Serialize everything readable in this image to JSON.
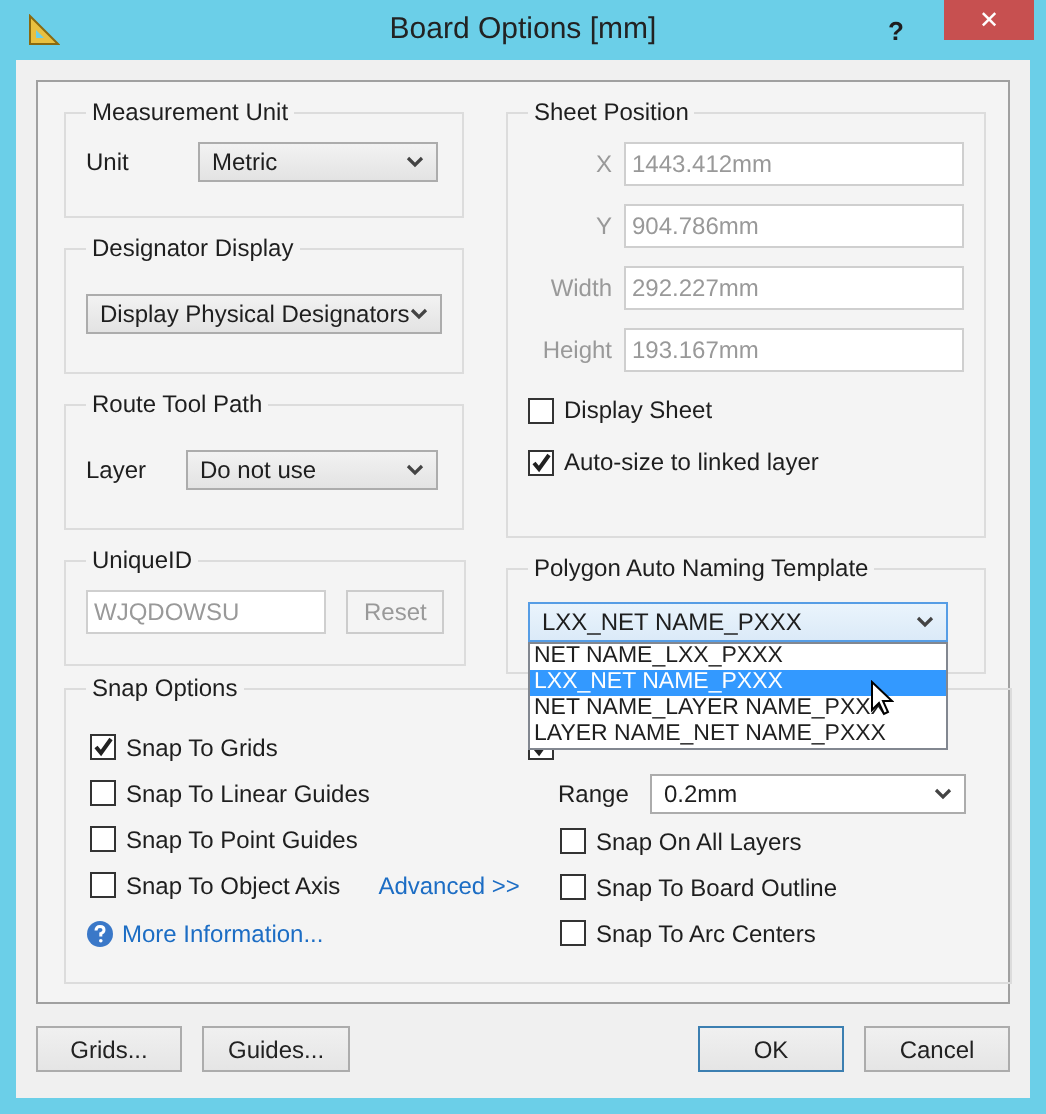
{
  "window": {
    "title": "Board Options [mm]",
    "help": "?",
    "close": "✕"
  },
  "measurement_unit": {
    "title": "Measurement Unit",
    "label": "Unit",
    "value": "Metric"
  },
  "designator_display": {
    "title": "Designator Display",
    "value": "Display Physical Designators"
  },
  "route_tool_path": {
    "title": "Route Tool Path",
    "label": "Layer",
    "value": "Do not use"
  },
  "unique_id": {
    "title": "UniqueID",
    "value": "WJQDOWSU",
    "button": "Reset",
    "disabled": true
  },
  "sheet_position": {
    "title": "Sheet Position",
    "disabled": true,
    "fields": [
      {
        "label": "X",
        "value": "1443.412mm"
      },
      {
        "label": "Y",
        "value": "904.786mm"
      },
      {
        "label": "Width",
        "value": "292.227mm"
      },
      {
        "label": "Height",
        "value": "193.167mm"
      }
    ],
    "checkboxes": [
      {
        "label": "Display Sheet",
        "checked": false
      },
      {
        "label": "Auto-size to linked layer",
        "checked": true
      }
    ]
  },
  "polygon_naming": {
    "title": "Polygon Auto Naming Template",
    "value": "LXX_NET NAME_PXXX",
    "expanded": true,
    "options": [
      {
        "label": "NET NAME_LXX_PXXX",
        "selected": false
      },
      {
        "label": "LXX_NET NAME_PXXX",
        "selected": true
      },
      {
        "label": "NET NAME_LAYER NAME_PXXX",
        "selected": false
      },
      {
        "label": "LAYER NAME_NET NAME_PXXX",
        "selected": false
      }
    ]
  },
  "snap_options": {
    "title": "Snap Options",
    "left": [
      {
        "label": "Snap To Grids",
        "checked": true
      },
      {
        "label": "Snap To Linear Guides",
        "checked": false
      },
      {
        "label": "Snap To Point Guides",
        "checked": false
      },
      {
        "label": "Snap To Object Axis",
        "checked": false
      }
    ],
    "advanced_link": "Advanced >>",
    "more_info": "More Information...",
    "hotspots": {
      "checked": true
    },
    "range_label": "Range",
    "range_value": "0.2mm",
    "right": [
      {
        "label": "Snap On All Layers",
        "checked": false
      },
      {
        "label": "Snap To Board Outline",
        "checked": false
      },
      {
        "label": "Snap To Arc Centers",
        "checked": false
      }
    ]
  },
  "buttons": [
    {
      "label": "Grids...",
      "default": false
    },
    {
      "label": "Guides...",
      "default": false
    },
    {
      "label": "OK",
      "default": true
    },
    {
      "label": "Cancel",
      "default": false
    }
  ]
}
